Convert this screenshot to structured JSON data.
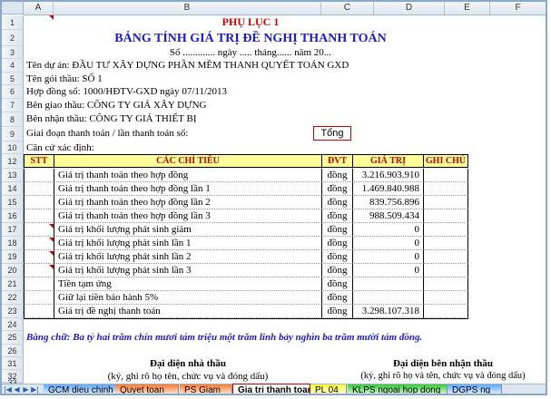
{
  "columns": [
    "A",
    "B",
    "C",
    "D",
    "E",
    "F"
  ],
  "rows": [
    "1",
    "2",
    "3",
    "4",
    "5",
    "6",
    "7",
    "8",
    "9",
    "10",
    "12",
    "13",
    "14",
    "15",
    "16",
    "17",
    "18",
    "19",
    "20",
    "21",
    "22",
    "23",
    "24",
    "25",
    "26",
    "31",
    "32",
    "33"
  ],
  "doc": {
    "appendix": "PHỤ LỤC 1",
    "title": "BẢNG TÍNH GIÁ TRỊ ĐỀ NGHỊ THANH TOÁN",
    "number_line": "Số ............. ngày ..... tháng...... năm 20...",
    "project": "Tên dự án: ĐẦU TƯ XÂY DỰNG PHẦN MỀM THANH QUYẾT TOÁN GXD",
    "package": "Tên gói thầu: SỐ 1",
    "contract": "Hợp đồng số: 1000/HĐTV-GXD ngày 07/11/2013",
    "delivering": "Bên giao thầu: CÔNG TY GIÁ XÂY DỰNG",
    "receiving": "Bên nhận thầu: CÔNG TY GIÁ THIẾT BỊ",
    "phase_label": "Giai đoạn thanh toán / lần thanh toán số:",
    "phase_value": "Tổng",
    "basis": "Căn cứ xác định:",
    "amount_words": "Bằng chữ: Ba tỷ hai trăm chín mươi tám triệu một trăm linh bảy nghìn ba trăm mười tám đồng."
  },
  "table": {
    "headers": {
      "stt": "STT",
      "chi_tieu": "CÁC CHỈ TIÊU",
      "dvt": "ĐVT",
      "gia_tri": "GIÁ TRỊ",
      "ghi_chu": "GHI CHÚ"
    },
    "rows": [
      {
        "label": "Giá trị thanh toán theo hợp đồng",
        "unit": "đồng",
        "value": "3.216.903.910"
      },
      {
        "label": "Giá trị thanh toán theo hợp đồng lần 1",
        "unit": "đồng",
        "value": "1.469.840.988"
      },
      {
        "label": "Giá trị thanh toán theo hợp đồng lần 2",
        "unit": "đồng",
        "value": "839.756.896"
      },
      {
        "label": "Giá trị thanh toán theo hợp đồng lần 3",
        "unit": "đồng",
        "value": "988.509.434"
      },
      {
        "label": "Giá trị khối lượng phát sinh giảm",
        "unit": "đồng",
        "value": "0"
      },
      {
        "label": "Giá trị khối lượng phát sinh lần 1",
        "unit": "đồng",
        "value": "0"
      },
      {
        "label": "Giá trị khối lượng phát sinh lần 2",
        "unit": "đồng",
        "value": "0"
      },
      {
        "label": "Giá trị khối lượng phát sinh lần 3",
        "unit": "đồng",
        "value": "0"
      },
      {
        "label": "Tiền tạm ứng",
        "unit": "đồng",
        "value": ""
      },
      {
        "label": "Giữ lại tiền bảo hành 5%",
        "unit": "đồng",
        "value": ""
      },
      {
        "label": "Giá trị đề nghị thanh toán",
        "unit": "đồng",
        "value": "3.298.107.318"
      }
    ]
  },
  "signatures": {
    "left_title": "Đại diện nhà thầu",
    "left_note": "(ký, ghi rõ họ tên, chức vụ và đóng dấu)",
    "right_title": "Đại diện bên nhận thầu",
    "right_note": "(ký, ghi rõ họ và tên, chức vụ và đóng dấu)"
  },
  "tabs": [
    {
      "label": "GCM dieu chinh",
      "color": "#5fa8ff",
      "active": false
    },
    {
      "label": "Quyet toan",
      "color": "#ff7a2e",
      "active": false
    },
    {
      "label": "PS Giam",
      "color": "#ff7a2e",
      "active": false
    },
    {
      "label": "Gia tri thanh toan",
      "color": "#ffffff",
      "active": true
    },
    {
      "label": "PL 04",
      "color": "#ffff33",
      "active": false
    },
    {
      "label": "KLPS ngoai hop dong",
      "color": "#33cc33",
      "active": false
    },
    {
      "label": "DGPS ng",
      "color": "#5fa8ff",
      "active": false
    }
  ],
  "nav_icons": [
    "first-sheet-icon",
    "prev-sheet-icon",
    "next-sheet-icon",
    "last-sheet-icon"
  ]
}
